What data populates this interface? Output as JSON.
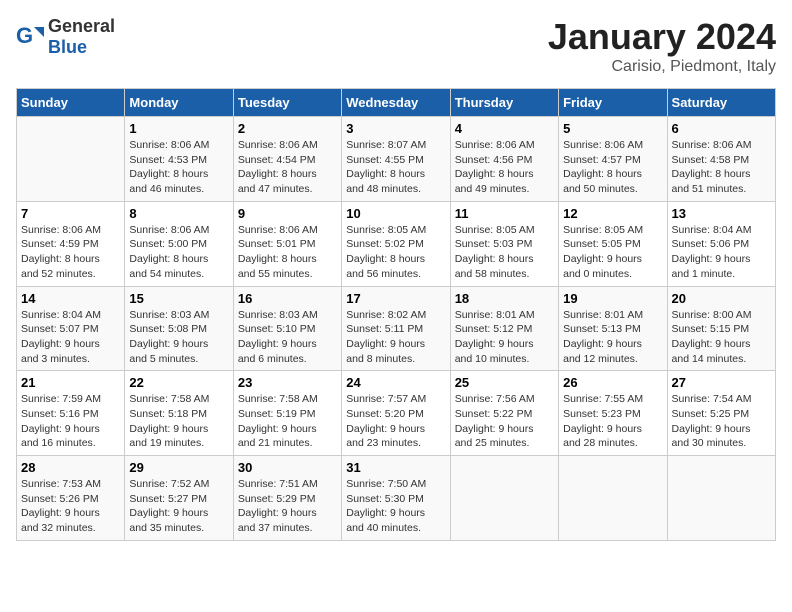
{
  "header": {
    "logo": {
      "general": "General",
      "blue": "Blue"
    },
    "title": "January 2024",
    "location": "Carisio, Piedmont, Italy"
  },
  "calendar": {
    "days_of_week": [
      "Sunday",
      "Monday",
      "Tuesday",
      "Wednesday",
      "Thursday",
      "Friday",
      "Saturday"
    ],
    "weeks": [
      [
        {
          "day": "",
          "info": ""
        },
        {
          "day": "1",
          "info": "Sunrise: 8:06 AM\nSunset: 4:53 PM\nDaylight: 8 hours\nand 46 minutes."
        },
        {
          "day": "2",
          "info": "Sunrise: 8:06 AM\nSunset: 4:54 PM\nDaylight: 8 hours\nand 47 minutes."
        },
        {
          "day": "3",
          "info": "Sunrise: 8:07 AM\nSunset: 4:55 PM\nDaylight: 8 hours\nand 48 minutes."
        },
        {
          "day": "4",
          "info": "Sunrise: 8:06 AM\nSunset: 4:56 PM\nDaylight: 8 hours\nand 49 minutes."
        },
        {
          "day": "5",
          "info": "Sunrise: 8:06 AM\nSunset: 4:57 PM\nDaylight: 8 hours\nand 50 minutes."
        },
        {
          "day": "6",
          "info": "Sunrise: 8:06 AM\nSunset: 4:58 PM\nDaylight: 8 hours\nand 51 minutes."
        }
      ],
      [
        {
          "day": "7",
          "info": "Sunrise: 8:06 AM\nSunset: 4:59 PM\nDaylight: 8 hours\nand 52 minutes."
        },
        {
          "day": "8",
          "info": "Sunrise: 8:06 AM\nSunset: 5:00 PM\nDaylight: 8 hours\nand 54 minutes."
        },
        {
          "day": "9",
          "info": "Sunrise: 8:06 AM\nSunset: 5:01 PM\nDaylight: 8 hours\nand 55 minutes."
        },
        {
          "day": "10",
          "info": "Sunrise: 8:05 AM\nSunset: 5:02 PM\nDaylight: 8 hours\nand 56 minutes."
        },
        {
          "day": "11",
          "info": "Sunrise: 8:05 AM\nSunset: 5:03 PM\nDaylight: 8 hours\nand 58 minutes."
        },
        {
          "day": "12",
          "info": "Sunrise: 8:05 AM\nSunset: 5:05 PM\nDaylight: 9 hours\nand 0 minutes."
        },
        {
          "day": "13",
          "info": "Sunrise: 8:04 AM\nSunset: 5:06 PM\nDaylight: 9 hours\nand 1 minute."
        }
      ],
      [
        {
          "day": "14",
          "info": "Sunrise: 8:04 AM\nSunset: 5:07 PM\nDaylight: 9 hours\nand 3 minutes."
        },
        {
          "day": "15",
          "info": "Sunrise: 8:03 AM\nSunset: 5:08 PM\nDaylight: 9 hours\nand 5 minutes."
        },
        {
          "day": "16",
          "info": "Sunrise: 8:03 AM\nSunset: 5:10 PM\nDaylight: 9 hours\nand 6 minutes."
        },
        {
          "day": "17",
          "info": "Sunrise: 8:02 AM\nSunset: 5:11 PM\nDaylight: 9 hours\nand 8 minutes."
        },
        {
          "day": "18",
          "info": "Sunrise: 8:01 AM\nSunset: 5:12 PM\nDaylight: 9 hours\nand 10 minutes."
        },
        {
          "day": "19",
          "info": "Sunrise: 8:01 AM\nSunset: 5:13 PM\nDaylight: 9 hours\nand 12 minutes."
        },
        {
          "day": "20",
          "info": "Sunrise: 8:00 AM\nSunset: 5:15 PM\nDaylight: 9 hours\nand 14 minutes."
        }
      ],
      [
        {
          "day": "21",
          "info": "Sunrise: 7:59 AM\nSunset: 5:16 PM\nDaylight: 9 hours\nand 16 minutes."
        },
        {
          "day": "22",
          "info": "Sunrise: 7:58 AM\nSunset: 5:18 PM\nDaylight: 9 hours\nand 19 minutes."
        },
        {
          "day": "23",
          "info": "Sunrise: 7:58 AM\nSunset: 5:19 PM\nDaylight: 9 hours\nand 21 minutes."
        },
        {
          "day": "24",
          "info": "Sunrise: 7:57 AM\nSunset: 5:20 PM\nDaylight: 9 hours\nand 23 minutes."
        },
        {
          "day": "25",
          "info": "Sunrise: 7:56 AM\nSunset: 5:22 PM\nDaylight: 9 hours\nand 25 minutes."
        },
        {
          "day": "26",
          "info": "Sunrise: 7:55 AM\nSunset: 5:23 PM\nDaylight: 9 hours\nand 28 minutes."
        },
        {
          "day": "27",
          "info": "Sunrise: 7:54 AM\nSunset: 5:25 PM\nDaylight: 9 hours\nand 30 minutes."
        }
      ],
      [
        {
          "day": "28",
          "info": "Sunrise: 7:53 AM\nSunset: 5:26 PM\nDaylight: 9 hours\nand 32 minutes."
        },
        {
          "day": "29",
          "info": "Sunrise: 7:52 AM\nSunset: 5:27 PM\nDaylight: 9 hours\nand 35 minutes."
        },
        {
          "day": "30",
          "info": "Sunrise: 7:51 AM\nSunset: 5:29 PM\nDaylight: 9 hours\nand 37 minutes."
        },
        {
          "day": "31",
          "info": "Sunrise: 7:50 AM\nSunset: 5:30 PM\nDaylight: 9 hours\nand 40 minutes."
        },
        {
          "day": "",
          "info": ""
        },
        {
          "day": "",
          "info": ""
        },
        {
          "day": "",
          "info": ""
        }
      ]
    ]
  }
}
